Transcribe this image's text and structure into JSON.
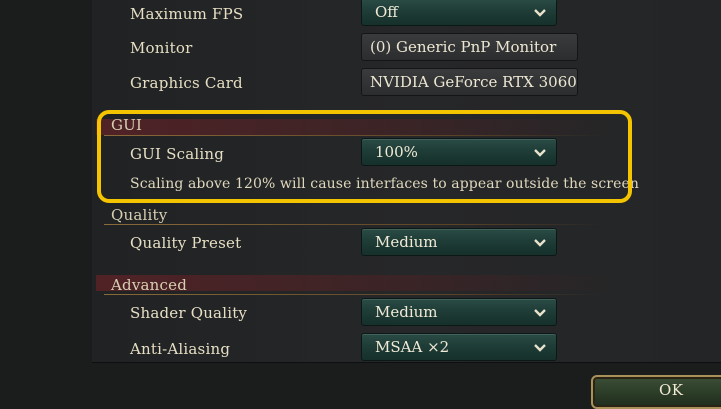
{
  "settings": {
    "max_fps": {
      "label": "Maximum FPS",
      "value": "Off"
    },
    "monitor": {
      "label": "Monitor",
      "value": "(0) Generic PnP Monitor"
    },
    "graphics_card": {
      "label": "Graphics Card",
      "value": "NVIDIA GeForce RTX 3060"
    }
  },
  "gui": {
    "title": "GUI",
    "scaling": {
      "label": "GUI Scaling",
      "value": "100%"
    },
    "warning": "Scaling above 120% will cause interfaces to appear outside the screen"
  },
  "quality": {
    "title": "Quality",
    "preset": {
      "label": "Quality Preset",
      "value": "Medium"
    }
  },
  "advanced": {
    "title": "Advanced",
    "shader": {
      "label": "Shader Quality",
      "value": "Medium"
    },
    "aa": {
      "label": "Anti-Aliasing",
      "value": "MSAA ×2"
    }
  },
  "footer": {
    "ok_label": "OK"
  },
  "colors": {
    "highlight": "#f4c400",
    "dropdown_bg": "#1d3a35",
    "text": "#e7dfc4"
  }
}
